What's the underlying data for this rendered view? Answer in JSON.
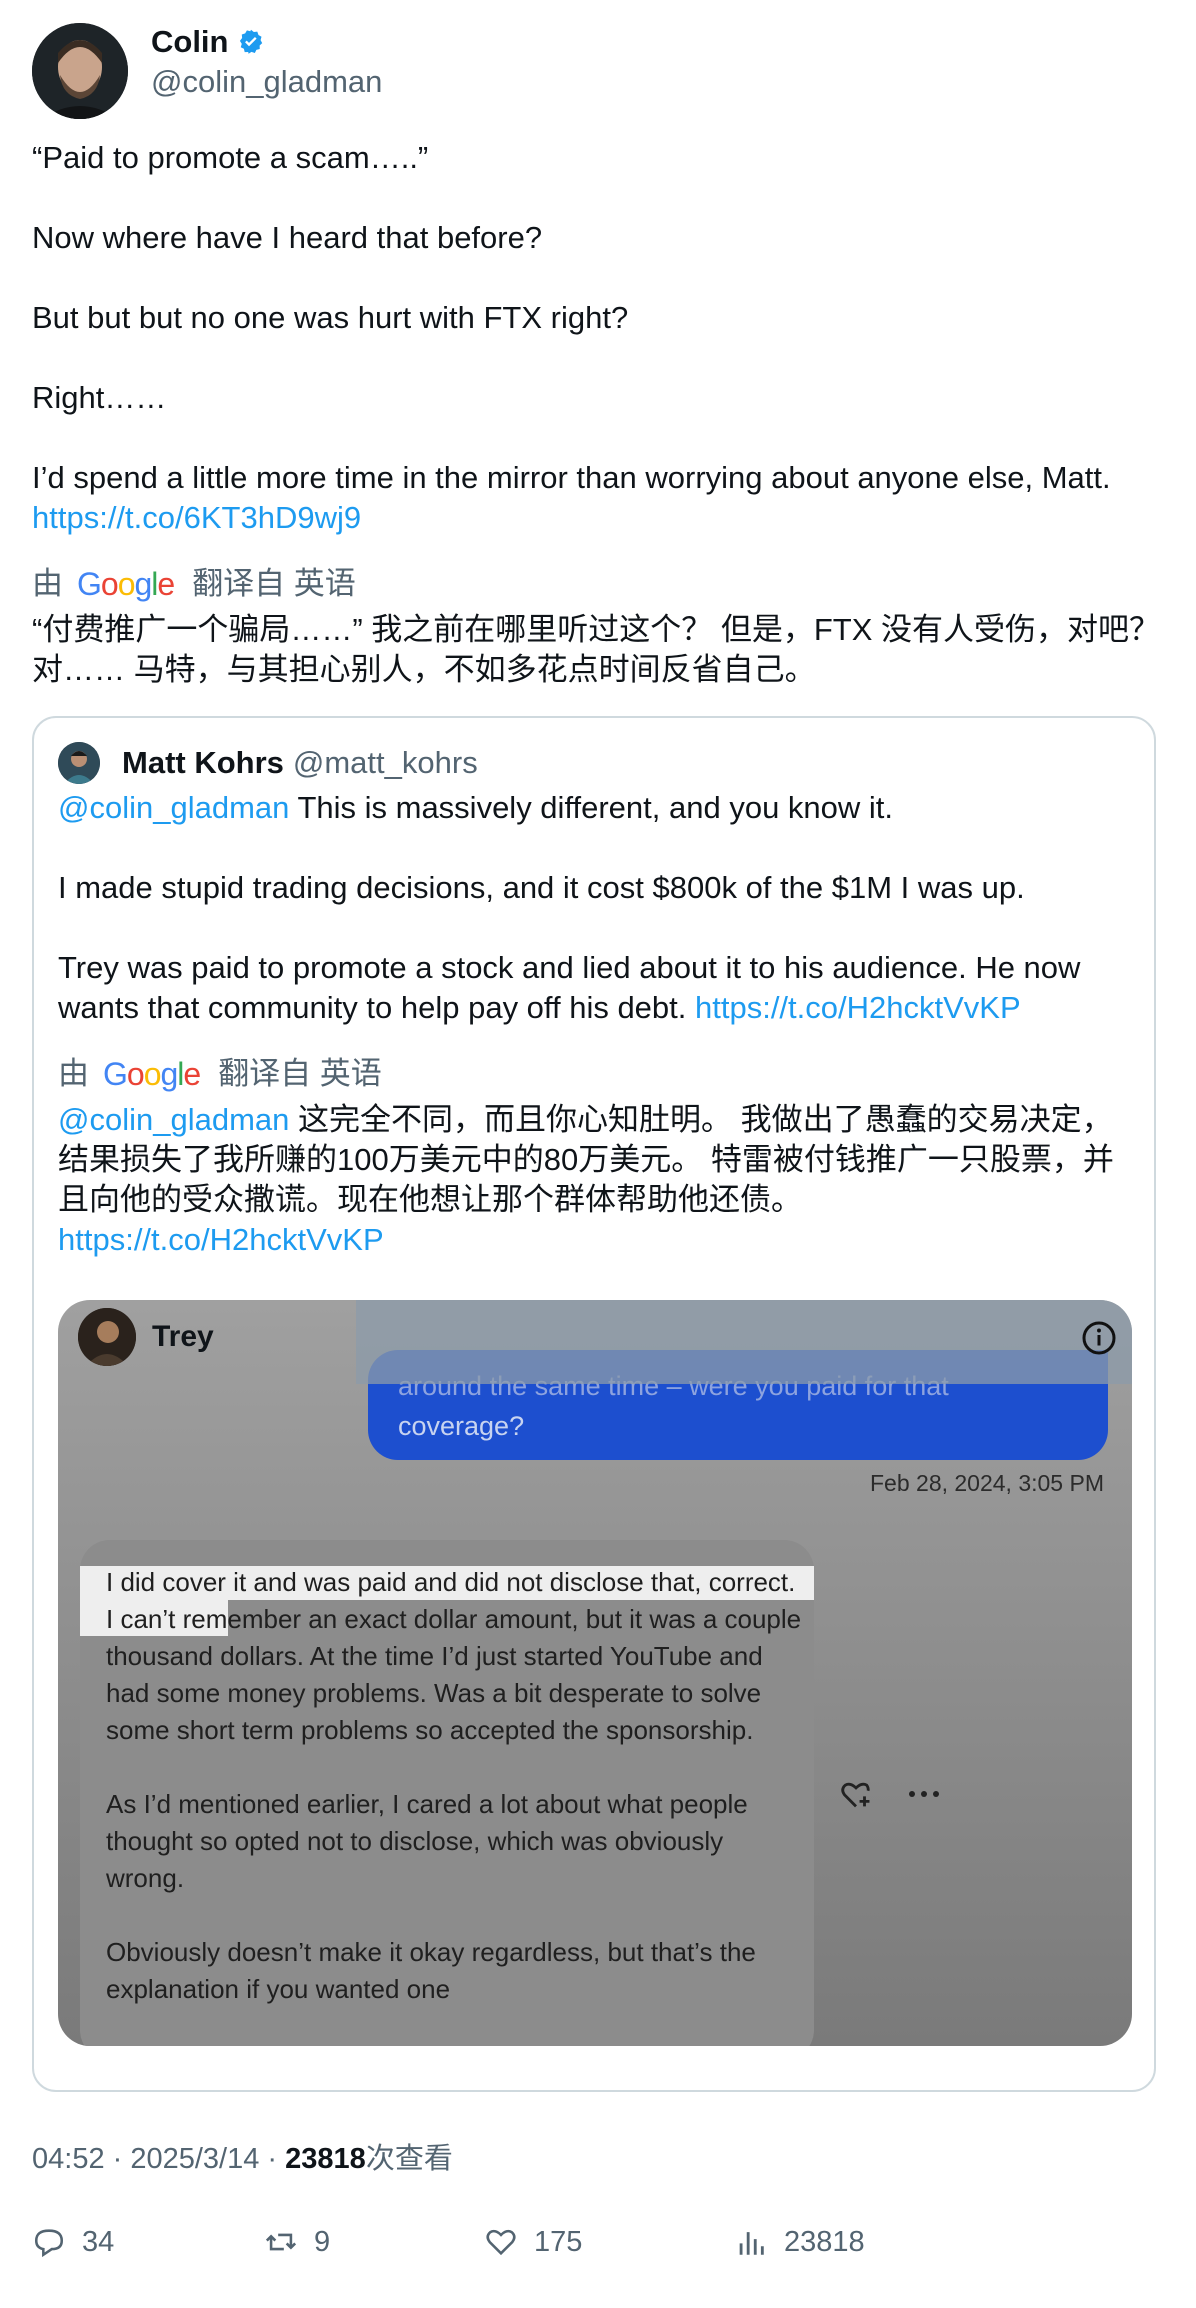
{
  "colors": {
    "link": "#1d9bf0",
    "verified": "#1d9bf0",
    "secondary": "#536471",
    "dm_blue": "#1d4fcf"
  },
  "author": {
    "name": "Colin",
    "handle": "@colin_gladman",
    "verified_icon": "verified-badge-icon"
  },
  "tweet": {
    "lines": [
      "“Paid to promote a scam…..”",
      "Now where have I heard that before?",
      "But but but no one was hurt with FTX right?",
      "Right……",
      "I’d spend a little more time in the mirror than worrying about anyone else, Matt."
    ],
    "link": "https://t.co/6KT3hD9wj9"
  },
  "translation": {
    "prefix": "由",
    "provider": "Google",
    "suffix": "翻译自 英语",
    "text": "“付费推广一个骗局……” 我之前在哪里听过这个？ 但是，FTX 没有人受伤，对吧？ 对…… 马特，与其担心别人，不如多花点时间反省自己。"
  },
  "quote": {
    "name": "Matt Kohrs",
    "handle": "@matt_kohrs",
    "mention": "@colin_gladman",
    "line1": " This is massively different, and you know it.",
    "line2": "I made stupid trading decisions, and it cost $800k of the $1M I was up.",
    "line3": "Trey was paid to promote a stock and lied about it to his audience. He now wants that community to help pay off his debt. ",
    "link": "https://t.co/H2hcktVvKP",
    "translation": {
      "prefix": "由",
      "provider": "Google",
      "suffix": "翻译自 英语",
      "mention": "@colin_gladman",
      "text": " 这完全不同，而且你心知肚明。 我做出了愚蠢的交易决定，结果损失了我所赚的100万美元中的80万美元。 特雷被付钱推广一只股票，并且向他的受众撒谎。现在他想让那个群体帮助他还债。",
      "link": "https://t.co/H2hcktVvKP"
    },
    "media": {
      "contact": "Trey",
      "blue_partial": "around the same time – were you paid for that",
      "blue_text": "coverage?",
      "timestamp": "Feb 28, 2024, 3:05 PM",
      "reply_paragraphs": [
        "I did cover it and was paid and did not disclose that, correct. I can’t remember an exact dollar amount, but it was a couple thousand dollars. At the time I’d just started YouTube and had some money problems. Was a bit desperate to solve some short term problems so accepted the sponsorship.",
        "As I’d mentioned earlier, I cared a lot about what people thought so opted not to disclose, which was obviously wrong.",
        "Obviously doesn’t make it okay regardless, but that’s the explanation if you wanted one"
      ]
    }
  },
  "meta": {
    "time": "04:52",
    "date": "2025/3/14",
    "views": "23818",
    "views_suffix": "次查看"
  },
  "actions": {
    "replies": "34",
    "retweets": "9",
    "likes": "175",
    "views": "23818"
  }
}
